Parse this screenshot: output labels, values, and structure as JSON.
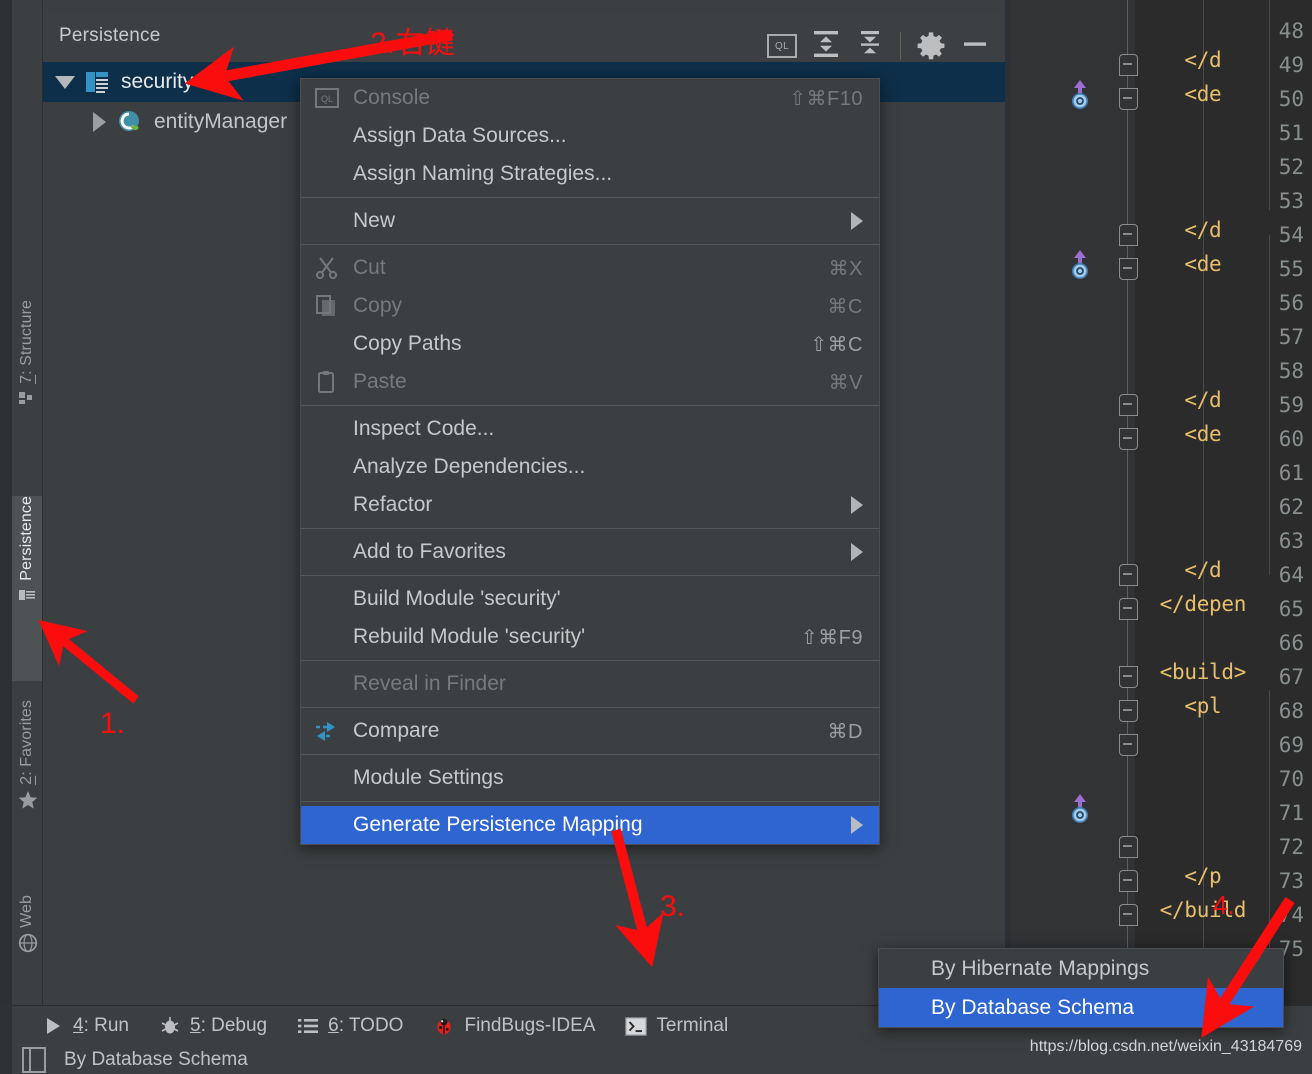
{
  "toolwindow": {
    "title": "Persistence",
    "tools": [
      {
        "name": "ql-console-button",
        "label": "QL"
      },
      {
        "name": "expand-all-button",
        "label": ""
      },
      {
        "name": "collapse-all-button",
        "label": ""
      },
      {
        "name": "settings-gear-button",
        "label": ""
      },
      {
        "name": "hide-window-button",
        "label": ""
      }
    ],
    "tree": [
      {
        "label": "security",
        "icon": "persistence-unit-icon",
        "expanded": true,
        "selected": true,
        "depth": 0
      },
      {
        "label": "entityManager",
        "icon": "spring-bean-icon",
        "expanded": false,
        "selected": false,
        "depth": 1
      }
    ]
  },
  "sidebar": {
    "tabs": [
      {
        "label": "7: Structure",
        "mnemonic": "7",
        "icon": "structure-icon",
        "active": false
      },
      {
        "label": "Persistence",
        "mnemonic": "",
        "icon": "persistence-icon",
        "active": true
      },
      {
        "label": "2: Favorites",
        "mnemonic": "2",
        "icon": "star-icon",
        "active": false
      },
      {
        "label": "Web",
        "mnemonic": "",
        "icon": "globe-icon",
        "active": false
      }
    ]
  },
  "context_menu": {
    "items": [
      {
        "label": "Console",
        "accel": "⇧⌘F10",
        "icon": "ql-icon",
        "disabled": true,
        "submenu": false
      },
      {
        "label": "Assign Data Sources...",
        "accel": "",
        "icon": "",
        "disabled": false,
        "submenu": false
      },
      {
        "label": "Assign Naming Strategies...",
        "accel": "",
        "icon": "",
        "disabled": false,
        "submenu": false
      },
      {
        "divider": true
      },
      {
        "label": "New",
        "accel": "",
        "icon": "",
        "disabled": false,
        "submenu": true
      },
      {
        "divider": true
      },
      {
        "label": "Cut",
        "accel": "⌘X",
        "icon": "scissors-icon",
        "disabled": true,
        "submenu": false
      },
      {
        "label": "Copy",
        "accel": "⌘C",
        "icon": "copy-icon",
        "disabled": true,
        "submenu": false
      },
      {
        "label": "Copy Paths",
        "accel": "⇧⌘C",
        "icon": "",
        "disabled": false,
        "submenu": false
      },
      {
        "label": "Paste",
        "accel": "⌘V",
        "icon": "clipboard-icon",
        "disabled": true,
        "submenu": false
      },
      {
        "divider": true
      },
      {
        "label": "Inspect Code...",
        "accel": "",
        "icon": "",
        "disabled": false,
        "submenu": false
      },
      {
        "label": "Analyze Dependencies...",
        "accel": "",
        "icon": "",
        "disabled": false,
        "submenu": false
      },
      {
        "label": "Refactor",
        "accel": "",
        "icon": "",
        "disabled": false,
        "submenu": true
      },
      {
        "divider": true
      },
      {
        "label": "Add to Favorites",
        "accel": "",
        "icon": "",
        "disabled": false,
        "submenu": true
      },
      {
        "divider": true
      },
      {
        "label": "Build Module 'security'",
        "accel": "",
        "icon": "",
        "disabled": false,
        "submenu": false
      },
      {
        "label": "Rebuild Module 'security'",
        "accel": "⇧⌘F9",
        "icon": "",
        "disabled": false,
        "submenu": false
      },
      {
        "divider": true
      },
      {
        "label": "Reveal in Finder",
        "accel": "",
        "icon": "",
        "disabled": true,
        "submenu": false
      },
      {
        "divider": true
      },
      {
        "label": "Compare",
        "accel": "⌘D",
        "icon": "compare-icon",
        "disabled": false,
        "submenu": false
      },
      {
        "divider": true
      },
      {
        "label": "Module Settings",
        "accel": "",
        "icon": "",
        "disabled": false,
        "submenu": false
      },
      {
        "divider": true
      },
      {
        "label": "Generate Persistence Mapping",
        "accel": "",
        "icon": "",
        "disabled": false,
        "submenu": true,
        "highlight": true
      }
    ]
  },
  "submenu": {
    "items": [
      {
        "label": "By Hibernate Mappings",
        "highlight": false
      },
      {
        "label": "By Database Schema",
        "highlight": true
      }
    ]
  },
  "editor": {
    "line_numbers": [
      48,
      49,
      50,
      51,
      52,
      53,
      54,
      55,
      56,
      57,
      58,
      59,
      60,
      61,
      62,
      63,
      64,
      65,
      66,
      67,
      68,
      69,
      70,
      71,
      72,
      73,
      74,
      75
    ],
    "code_lines": [
      {
        "line": 49,
        "text": "    </d"
      },
      {
        "line": 50,
        "text": "    <de"
      },
      {
        "line": 54,
        "text": "    </d"
      },
      {
        "line": 55,
        "text": "    <de"
      },
      {
        "line": 59,
        "text": "    </d"
      },
      {
        "line": 60,
        "text": "    <de"
      },
      {
        "line": 64,
        "text": "    </d"
      },
      {
        "line": 65,
        "text": "  </depen"
      },
      {
        "line": 67,
        "text": "  <build>"
      },
      {
        "line": 68,
        "text": "    <pl"
      },
      {
        "line": 73,
        "text": "    </p"
      },
      {
        "line": 74,
        "text": "  </build"
      }
    ],
    "fold_open_lines": [
      50,
      55,
      60,
      67,
      68,
      69
    ],
    "fold_close_lines": [
      49,
      54,
      59,
      64,
      65,
      72,
      73,
      74
    ],
    "vcs_mark_lines": [
      50,
      55,
      71
    ]
  },
  "bottom_toolbar": {
    "items": [
      {
        "label": "4: Run",
        "mnemonic": "4",
        "icon": "run-icon"
      },
      {
        "label": "5: Debug",
        "mnemonic": "5",
        "icon": "debug-icon"
      },
      {
        "label": "6: TODO",
        "mnemonic": "6",
        "icon": "todo-icon"
      },
      {
        "label": "FindBugs-IDEA",
        "mnemonic": "",
        "icon": "findbugs-icon"
      },
      {
        "label": "Terminal",
        "mnemonic": "",
        "icon": "terminal-icon"
      }
    ]
  },
  "statusbar": {
    "text": "By Database Schema",
    "icon": "memory-icon"
  },
  "watermark": "https://blog.csdn.net/weixin_43184769",
  "annotations": [
    {
      "name": "step-1-label",
      "text": "1."
    },
    {
      "name": "step-2-label",
      "text": "2.右键"
    },
    {
      "name": "step-3-label",
      "text": "3."
    },
    {
      "name": "step-4-label",
      "text": "4."
    }
  ],
  "colors": {
    "accent_blue": "#2f65d0",
    "selection_blue": "#0d2f4a",
    "annotation_red": "#fb0d0d",
    "xml_tag": "#e8bf6a",
    "panel_bg": "#3c3f41",
    "editor_bg": "#2b2b2b"
  }
}
